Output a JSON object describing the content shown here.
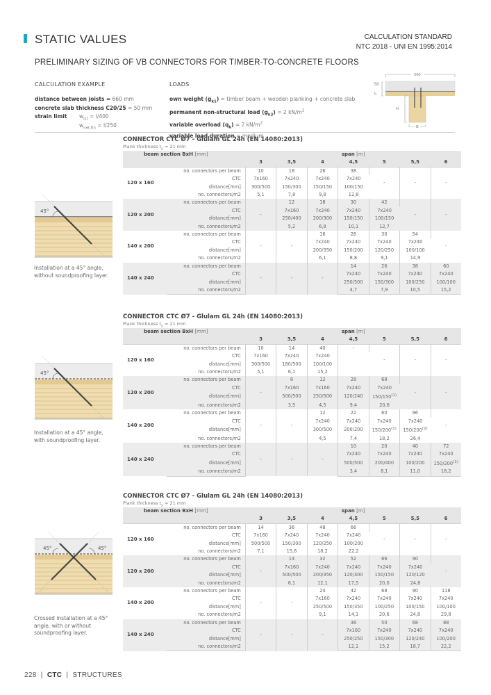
{
  "header": {
    "title": "STATIC VALUES",
    "calc_standard_label": "CALCULATION STANDARD",
    "calc_standard_value": "NTC 2018 - UNI EN 1995:2014",
    "subtitle": "PRELIMINARY SIZING OF VB CONNECTORS FOR TIMBER-TO-CONCRETE FLOORS",
    "accent_color": "#1aa7c9"
  },
  "calculation_example": {
    "label": "CALCULATION EXAMPLE",
    "joists_label": "distance between joists",
    "joists_value": "660 mm",
    "slab_label": "concrete slab thickness C20/25",
    "slab_value": "50 mm",
    "strain_label": "strain limit",
    "w_ist": "l/400",
    "w_net_fin": "l/250"
  },
  "loads": {
    "label": "LOADS",
    "own_weight_label": "own weight",
    "own_weight_value": "timber beam + wooden planking + concrete slab",
    "permanent_label": "permanent non-structural load",
    "permanent_value": "2 kN/m",
    "variable_label": "variable overload",
    "variable_value": "2 kN/m",
    "duration_label": "variable load duration",
    "duration_value": "medium"
  },
  "diagram": {
    "width_label": "660",
    "slab_label": "50",
    "ts_label": "t",
    "h_label": "H",
    "b_label": "B"
  },
  "header_row": {
    "section_label": "beam section BxH",
    "section_unit": "[mm]",
    "span_label": "span",
    "span_unit": "[m]",
    "spans": [
      "3",
      "3,5",
      "4",
      "4,5",
      "5",
      "5,5",
      "6"
    ]
  },
  "row_labels": [
    "no. connectors per beam",
    "CTC",
    "distance[mm]",
    "no. connectors/m2"
  ],
  "tables": [
    {
      "title": "CONNECTOR CTC Ø7 - Glulam GL 24h (EN 14080:2013)",
      "plank": "Plank thickness t",
      "plank_value": "= 21 mm",
      "caption": "Installation at a 45° angle, without soundproofing layer.",
      "angle_label": "45°",
      "sections": [
        {
          "name": "120 x 160",
          "cols": [
            [
              "10",
              "7x160",
              "300/500",
              "5,1"
            ],
            [
              "18",
              "7x240",
              "150/300",
              "7,8"
            ],
            [
              "26",
              "7x240",
              "150/150",
              "9,8"
            ],
            [
              "38",
              "7x240",
              "100/150",
              "12,8"
            ],
            "-",
            "-",
            "-"
          ]
        },
        {
          "name": "120 x 200",
          "cols": [
            "-",
            [
              "12",
              "7x160",
              "250/400",
              "5,2"
            ],
            [
              "18",
              "7x240",
              "200/300",
              "6,8"
            ],
            [
              "30",
              "7x240",
              "150/150",
              "10,1"
            ],
            [
              "42",
              "7x240",
              "100/150",
              "12,7"
            ],
            "-",
            "-"
          ]
        },
        {
          "name": "140 x 200",
          "cols": [
            "-",
            "-",
            [
              "16",
              "7x240",
              "200/350",
              "6,1"
            ],
            [
              "26",
              "7x240",
              "150/200",
              "8,8"
            ],
            [
              "30",
              "7x240",
              "120/250",
              "9,1"
            ],
            [
              "54",
              "7x240",
              "100/100",
              "14,9"
            ],
            "-"
          ]
        },
        {
          "name": "140 x 240",
          "cols": [
            "-",
            "-",
            "-",
            [
              "14",
              "7x240",
              "250/500",
              "4,7"
            ],
            [
              "26",
              "7x240",
              "150/300",
              "7,9"
            ],
            [
              "38",
              "7x240",
              "100/250",
              "10,5"
            ],
            [
              "60",
              "7x240",
              "100/100",
              "15,2"
            ]
          ]
        }
      ]
    },
    {
      "title": "CONNECTOR CTC Ø7 - Glulam GL 24h (EN 14080:2013)",
      "plank": "Plank thickness t",
      "plank_value": "= 21 mm",
      "caption": "Installation at a 45° angle, with soundproofing layer.",
      "angle_label": "45°",
      "sections": [
        {
          "name": "120 x 160",
          "cols": [
            [
              "10",
              "7x160",
              "300/500",
              "5,1"
            ],
            [
              "14",
              "7x240",
              "180/500",
              "6,1"
            ],
            [
              "40",
              "7x240",
              "100/100",
              "15,2"
            ],
            [
              "-",
              "",
              "",
              ""
            ],
            "-",
            "-",
            "-"
          ]
        },
        {
          "name": "120 x 200",
          "cols": [
            "-",
            [
              "8",
              "7x160",
              "500/500",
              "3,5"
            ],
            [
              "12",
              "7x160",
              "250/500",
              "4,5"
            ],
            [
              "28",
              "7x240",
              "120/240",
              "9,4"
            ],
            [
              "68",
              "7x240",
              "150/150(1)",
              "20,6"
            ],
            "-",
            "-"
          ]
        },
        {
          "name": "140 x 200",
          "cols": [
            "-",
            "-",
            [
              "12",
              "7x240",
              "300/500",
              "4,5"
            ],
            [
              "22",
              "7x240",
              "200/200",
              "7,4"
            ],
            [
              "60",
              "7x240",
              "150/200(1)",
              "18,2"
            ],
            [
              "96",
              "7x240",
              "150/200(2)",
              "26,4"
            ],
            "-"
          ]
        },
        {
          "name": "140 x 240",
          "cols": [
            "-",
            "-",
            "-",
            [
              "10",
              "7x240",
              "500/500",
              "3,4"
            ],
            [
              "20",
              "7x240",
              "200/400",
              "6,1"
            ],
            [
              "40",
              "7x240",
              "100/200",
              "11,0"
            ],
            [
              "72",
              "7x240",
              "150/200(1)",
              "18,2"
            ]
          ]
        }
      ]
    },
    {
      "title": "CONNECTOR CTC Ø7 - Glulam GL 24h (EN 14080:2013)",
      "plank": "Plank thickness t",
      "plank_value": "= 21 mm",
      "caption": "Crossed installation at a 45° angle, with or without soundproofing layer.",
      "angle_label": "45°",
      "sections": [
        {
          "name": "120 x 160",
          "cols": [
            [
              "14",
              "7x160",
              "500/500",
              "7,1"
            ],
            [
              "36",
              "7x240",
              "150/300",
              "15,6"
            ],
            [
              "48",
              "7x240",
              "120/250",
              "18,2"
            ],
            [
              "66",
              "7x240",
              "100/200",
              "22,2"
            ],
            "-",
            "-",
            "-"
          ]
        },
        {
          "name": "120 x 200",
          "cols": [
            "-",
            [
              "14",
              "7x160",
              "500/500",
              "6,1"
            ],
            [
              "32",
              "7x240",
              "200/350",
              "12,1"
            ],
            [
              "52",
              "7x240",
              "120/300",
              "17,5"
            ],
            [
              "66",
              "7x240",
              "150/150",
              "20,0"
            ],
            [
              "90",
              "7x240",
              "120/120",
              "24,8"
            ],
            "-"
          ]
        },
        {
          "name": "140 x 200",
          "cols": [
            "-",
            "-",
            [
              "24",
              "7x160",
              "250/500",
              "9,1"
            ],
            [
              "42",
              "7x240",
              "150/350",
              "14,1"
            ],
            [
              "68",
              "7x240",
              "100/250",
              "20,6"
            ],
            [
              "90",
              "7x240",
              "100/150",
              "24,8"
            ],
            [
              "118",
              "7x240",
              "100/100",
              "29,8"
            ]
          ]
        },
        {
          "name": "140 x 240",
          "cols": [
            "-",
            "-",
            "-",
            [
              "36",
              "7x160",
              "250/250",
              "12,1"
            ],
            [
              "50",
              "7x240",
              "150/300",
              "15,2"
            ],
            [
              "68",
              "7x240",
              "120/240",
              "18,7"
            ],
            [
              "88",
              "7x240",
              "100/200",
              "22,2"
            ]
          ]
        }
      ]
    }
  ],
  "footer": {
    "page": "228",
    "product": "CTC",
    "section": "STRUCTURES"
  }
}
